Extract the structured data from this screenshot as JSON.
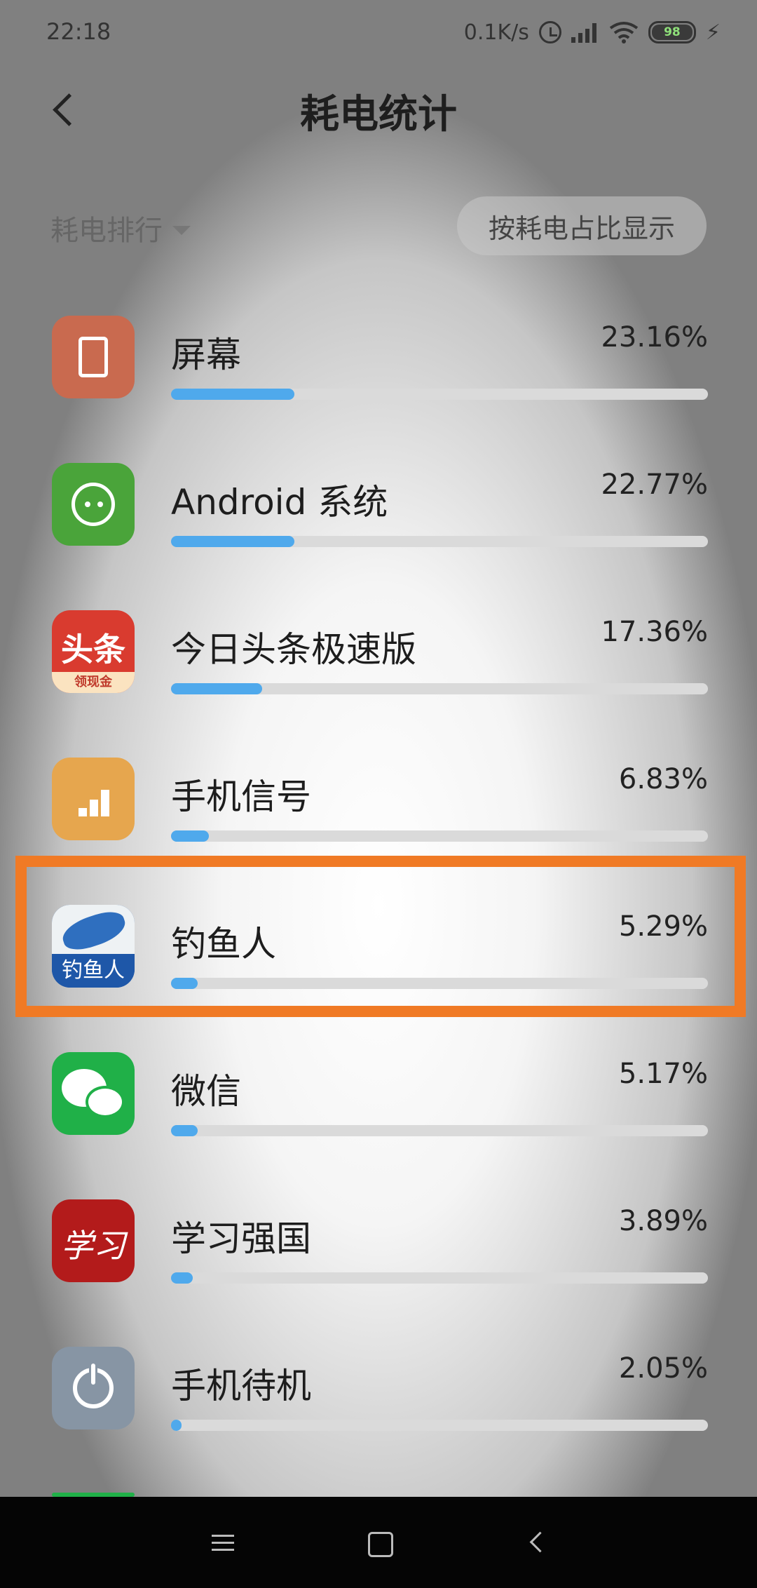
{
  "status_bar": {
    "time": "22:18",
    "network_speed": "0.1K/s",
    "battery_level": "98",
    "icons": [
      "alarm-icon",
      "signal-icon",
      "wifi-icon",
      "battery-icon",
      "charging-icon"
    ]
  },
  "header": {
    "title": "耗电统计",
    "back_icon": "back-arrow-icon"
  },
  "filters": {
    "sort_label": "耗电排行",
    "display_toggle": "按耗电占比显示"
  },
  "usage_list": [
    {
      "name": "屏幕",
      "percent": "23.16%",
      "bar_fraction": 0.23,
      "icon": "screen-icon",
      "icon_color": "#c96a4f"
    },
    {
      "name": "Android 系统",
      "percent": "22.77%",
      "bar_fraction": 0.23,
      "icon": "android-icon",
      "icon_color": "#4aa43a"
    },
    {
      "name": "今日头条极速版",
      "percent": "17.36%",
      "bar_fraction": 0.17,
      "icon": "toutiao-icon",
      "icon_color": "#d93b2f",
      "icon_text": "头条",
      "icon_badge": "领现金"
    },
    {
      "name": "手机信号",
      "percent": "6.83%",
      "bar_fraction": 0.07,
      "icon": "cellular-signal-icon",
      "icon_color": "#e6a64e"
    },
    {
      "name": "钓鱼人",
      "percent": "5.29%",
      "bar_fraction": 0.05,
      "icon": "fish-icon",
      "icon_color": "#1e57a8",
      "icon_text": "钓鱼人",
      "highlighted": true
    },
    {
      "name": "微信",
      "percent": "5.17%",
      "bar_fraction": 0.05,
      "icon": "wechat-icon",
      "icon_color": "#20b048"
    },
    {
      "name": "学习强国",
      "percent": "3.89%",
      "bar_fraction": 0.04,
      "icon": "xuexi-icon",
      "icon_color": "#b31b1b",
      "icon_text": "学习"
    },
    {
      "name": "手机待机",
      "percent": "2.05%",
      "bar_fraction": 0.02,
      "icon": "power-icon",
      "icon_color": "#5d6e80"
    }
  ],
  "colors": {
    "accent_bar": "#4fa9ec",
    "highlight_border": "#f07a25"
  },
  "nav_bar": {
    "icons": [
      "menu-icon",
      "home-icon",
      "back-icon"
    ]
  }
}
